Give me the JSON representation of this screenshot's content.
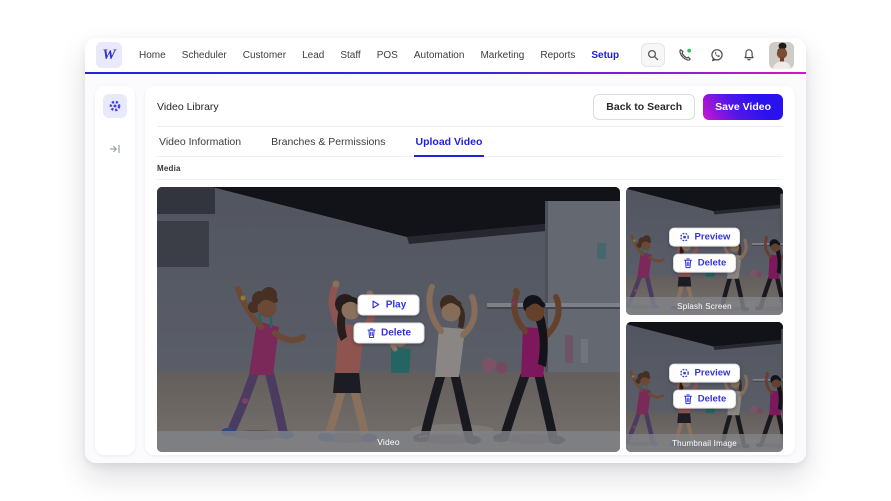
{
  "brand": {
    "logo_letter": "W"
  },
  "topnav": {
    "items": [
      {
        "label": "Home",
        "active": false
      },
      {
        "label": "Scheduler",
        "active": false
      },
      {
        "label": "Customer",
        "active": false
      },
      {
        "label": "Lead",
        "active": false
      },
      {
        "label": "Staff",
        "active": false
      },
      {
        "label": "POS",
        "active": false
      },
      {
        "label": "Automation",
        "active": false
      },
      {
        "label": "Marketing",
        "active": false
      },
      {
        "label": "Reports",
        "active": false
      },
      {
        "label": "Setup",
        "active": true
      }
    ],
    "icons": [
      "search-icon",
      "phone-icon",
      "whatsapp-icon",
      "bell-icon"
    ]
  },
  "header": {
    "title": "Video Library",
    "back_button": "Back to Search",
    "save_button": "Save Video"
  },
  "tabs": {
    "items": [
      {
        "label": "Video Information",
        "active": false
      },
      {
        "label": "Branches & Permissions",
        "active": false
      },
      {
        "label": "Upload Video",
        "active": true
      }
    ]
  },
  "media": {
    "section_label": "Media",
    "video": {
      "caption": "Video",
      "play_label": "Play",
      "delete_label": "Delete"
    },
    "splash": {
      "caption": "Splash Screen",
      "preview_label": "Preview",
      "delete_label": "Delete"
    },
    "thumbnail": {
      "caption": "Thumbnail Image",
      "preview_label": "Preview",
      "delete_label": "Delete"
    }
  },
  "colors": {
    "accent_blue": "#2121dc",
    "accent_magenta": "#d714c4",
    "button_text_blue": "#3434da",
    "online_dot_green": "#22c55e"
  }
}
